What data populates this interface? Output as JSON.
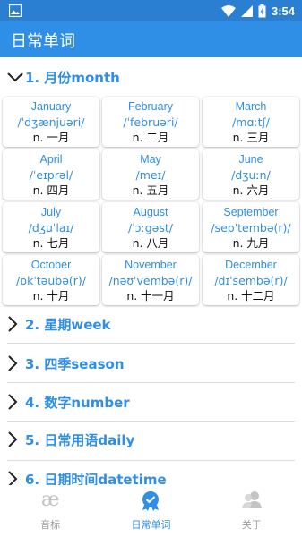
{
  "status_bar": {
    "time": "3:54",
    "icons": [
      "gallery-icon",
      "wifi-icon",
      "signal-icon",
      "battery-icon"
    ]
  },
  "app_bar": {
    "title": "日常单词"
  },
  "sections": [
    {
      "label": "1. 月份month",
      "expanded": true,
      "words": [
        {
          "word": "January",
          "phonetic": "/ˈdʒænjuəri/",
          "meaning": "n. 一月"
        },
        {
          "word": "February",
          "phonetic": "/ˈfebruəri/",
          "meaning": "n. 二月"
        },
        {
          "word": "March",
          "phonetic": "/mɑːtʃ/",
          "meaning": "n. 三月"
        },
        {
          "word": "April",
          "phonetic": "/ˈeɪprəl/",
          "meaning": "n. 四月"
        },
        {
          "word": "May",
          "phonetic": "/meɪ/",
          "meaning": "n. 五月"
        },
        {
          "word": "June",
          "phonetic": "/dʒuːn/",
          "meaning": "n. 六月"
        },
        {
          "word": "July",
          "phonetic": "/dʒuˈlaɪ/",
          "meaning": "n. 七月"
        },
        {
          "word": "August",
          "phonetic": "/ˈɔːgəst/",
          "meaning": "n. 八月"
        },
        {
          "word": "September",
          "phonetic": "/sepˈtembə(r)/",
          "meaning": "n. 九月"
        },
        {
          "word": "October",
          "phonetic": "/ɒkˈtəubə(r)/",
          "meaning": "n. 十月"
        },
        {
          "word": "November",
          "phonetic": "/nəʊˈvembə(r)/",
          "meaning": "n. 十一月"
        },
        {
          "word": "December",
          "phonetic": "/dɪˈsembə(r)/",
          "meaning": "n. 十二月"
        }
      ]
    },
    {
      "label": "2. 星期week",
      "expanded": false
    },
    {
      "label": "3. 四季season",
      "expanded": false
    },
    {
      "label": "4. 数字number",
      "expanded": false
    },
    {
      "label": "5. 日常用语daily",
      "expanded": false
    },
    {
      "label": "6. 日期时间datetime",
      "expanded": false
    }
  ],
  "bottom_nav": [
    {
      "label": "音标",
      "icon": "ae-ligature-icon",
      "active": false
    },
    {
      "label": "日常单词",
      "icon": "badge-check-icon",
      "active": true
    },
    {
      "label": "关于",
      "icon": "people-icon",
      "active": false
    }
  ],
  "colors": {
    "status_bar": "#2a7fd2",
    "app_bar": "#2f8ee5",
    "accent": "#2f8ee5",
    "inactive": "#9a9a9a"
  }
}
